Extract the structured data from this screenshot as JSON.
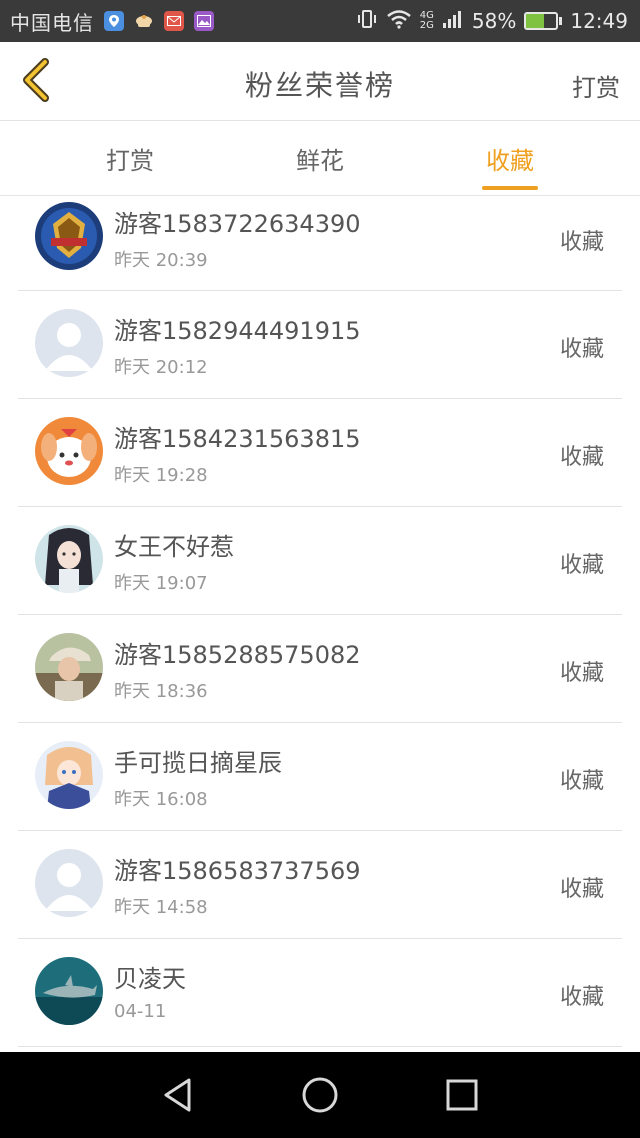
{
  "status_bar": {
    "carrier": "中国电信",
    "network_top": "4G",
    "network_bottom": "2G",
    "battery_percent": "58%",
    "battery_level": 0.58,
    "time": "12:49",
    "icons": [
      "location-icon",
      "teacup-icon",
      "mail-icon",
      "gallery-icon",
      "vibrate-icon",
      "wifi-icon",
      "signal-icon",
      "battery-icon"
    ]
  },
  "header": {
    "title": "粉丝荣誉榜",
    "action": "打赏"
  },
  "tabs": [
    {
      "label": "打赏",
      "active": false
    },
    {
      "label": "鲜花",
      "active": false
    },
    {
      "label": "收藏",
      "active": true
    }
  ],
  "colors": {
    "accent": "#f0a020",
    "status_bar_bg": "#3a3a3a",
    "nav_bar_bg": "#000000",
    "divider": "#e3e3e3"
  },
  "fans": [
    {
      "name": "游客1583722634390",
      "time": "昨天 20:39",
      "action": "收藏",
      "avatar": "game-badge-avatar"
    },
    {
      "name": "游客1582944491915",
      "time": "昨天 20:12",
      "action": "收藏",
      "avatar": "default-avatar"
    },
    {
      "name": "游客1584231563815",
      "time": "昨天 19:28",
      "action": "收藏",
      "avatar": "cartoon-dog-avatar"
    },
    {
      "name": "女王不好惹",
      "time": "昨天 19:07",
      "action": "收藏",
      "avatar": "anime-girl-avatar"
    },
    {
      "name": "游客1585288575082",
      "time": "昨天 18:36",
      "action": "收藏",
      "avatar": "photo-avatar"
    },
    {
      "name": "手可揽日摘星辰",
      "time": "昨天 16:08",
      "action": "收藏",
      "avatar": "anime-boy-avatar"
    },
    {
      "name": "游客1586583737569",
      "time": "昨天 14:58",
      "action": "收藏",
      "avatar": "default-avatar"
    },
    {
      "name": "贝凌天",
      "time": "04-11",
      "action": "收藏",
      "avatar": "shark-avatar"
    }
  ]
}
